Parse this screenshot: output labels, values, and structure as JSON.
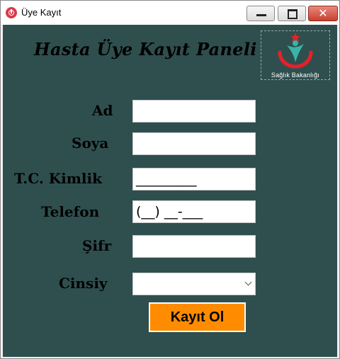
{
  "window": {
    "title": "Üye Kayıt",
    "close_glyph": "✕"
  },
  "header": {
    "panel_title": "Hasta Üye Kayıt Paneli",
    "logo_text": "Sağlık Bakanlığı",
    "logo_icon": "ministry-of-health-logo"
  },
  "form": {
    "ad_label": "Ad",
    "soyad_label": "Soya",
    "tc_label": "T.C. Kimlik",
    "tc_value": "_________",
    "telefon_label": "Telefon",
    "telefon_value": "(__) __-___",
    "sifre_label": "Şifr",
    "cinsiyet_label": "Cinsiy",
    "cinsiyet_value": "",
    "submit_label": "Kayıt Ol"
  },
  "colors": {
    "background": "#2f4f4f",
    "button": "#ff8c00",
    "logo_red": "#e8202a",
    "logo_teal": "#39b5a6"
  }
}
